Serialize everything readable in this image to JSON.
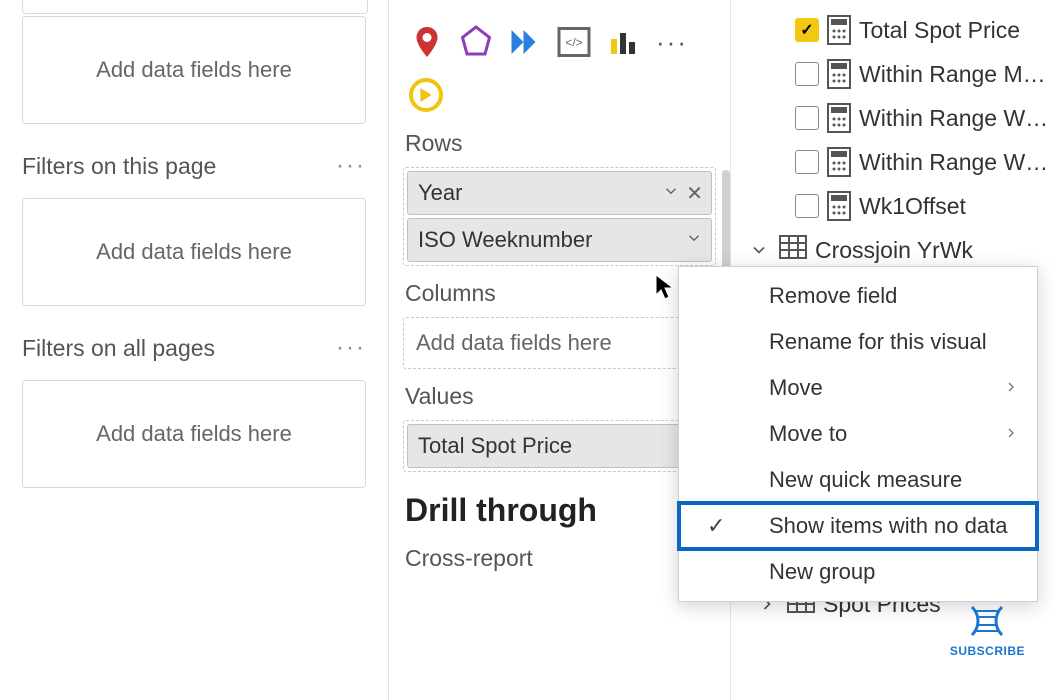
{
  "filters": {
    "add_placeholder": "Add data fields here",
    "section_page": "Filters on this page",
    "section_all": "Filters on all pages",
    "more": "···"
  },
  "viz": {
    "rows_label": "Rows",
    "columns_label": "Columns",
    "values_label": "Values",
    "drill_label": "Drill through",
    "cross_report": "Cross-report",
    "add_placeholder": "Add data fields here",
    "row_items": [
      "Year",
      "ISO Weeknumber"
    ],
    "value_items": [
      "Total Spot Price"
    ],
    "more": "···"
  },
  "fields": {
    "measures": [
      {
        "name": "Total Spot Price",
        "checked": true
      },
      {
        "name": "Within Range M…",
        "checked": false
      },
      {
        "name": "Within Range W…",
        "checked": false
      },
      {
        "name": "Within Range W…",
        "checked": false
      },
      {
        "name": "Wk1Offset",
        "checked": false
      }
    ],
    "tables": [
      {
        "name": "Crossjoin YrWk",
        "expanded": true
      },
      {
        "name": "Spot Prices",
        "expanded": false
      }
    ]
  },
  "menu": {
    "items": [
      {
        "label": "Remove field"
      },
      {
        "label": "Rename for this visual"
      },
      {
        "label": "Move",
        "submenu": true
      },
      {
        "label": "Move to",
        "submenu": true
      },
      {
        "label": "New quick measure"
      },
      {
        "label": "Show items with no data",
        "checked": true,
        "highlight": true
      },
      {
        "label": "New group"
      }
    ]
  },
  "subscribe": "SUBSCRIBE"
}
